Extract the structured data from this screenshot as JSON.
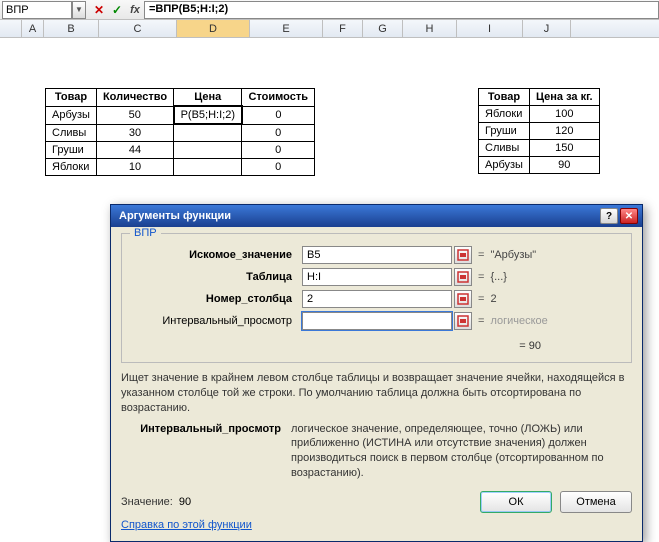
{
  "formula_bar": {
    "name_box": "ВПР",
    "formula": "=ВПР(B5;H:I;2)"
  },
  "columns": {
    "A": "A",
    "B": "B",
    "C": "C",
    "D": "D",
    "E": "E",
    "F": "F",
    "G": "G",
    "H": "H",
    "I": "I",
    "J": "J"
  },
  "main_table": {
    "headers": {
      "tovar": "Товар",
      "qty": "Количество",
      "price": "Цена",
      "cost": "Стоимость"
    },
    "rows": [
      {
        "tovar": "Арбузы",
        "qty": "50",
        "price": "Р(B5;H:I;2)",
        "cost": "0"
      },
      {
        "tovar": "Сливы",
        "qty": "30",
        "price": "",
        "cost": "0"
      },
      {
        "tovar": "Груши",
        "qty": "44",
        "price": "",
        "cost": "0"
      },
      {
        "tovar": "Яблоки",
        "qty": "10",
        "price": "",
        "cost": "0"
      }
    ]
  },
  "price_table": {
    "headers": {
      "tovar": "Товар",
      "ppkg": "Цена за кг."
    },
    "rows": [
      {
        "tovar": "Яблоки",
        "price": "100"
      },
      {
        "tovar": "Груши",
        "price": "120"
      },
      {
        "tovar": "Сливы",
        "price": "150"
      },
      {
        "tovar": "Арбузы",
        "price": "90"
      }
    ]
  },
  "dialog": {
    "title": "Аргументы функции",
    "func_name": "ВПР",
    "labels": {
      "lookup": "Искомое_значение",
      "table": "Таблица",
      "col": "Номер_столбца",
      "range": "Интервальный_просмотр"
    },
    "values": {
      "lookup": "B5",
      "table": "H:I",
      "col": "2",
      "range": ""
    },
    "evals": {
      "lookup": "\"Арбузы\"",
      "table": "{...}",
      "col": "2",
      "range": "логическое"
    },
    "result_eq": "= 90",
    "description": "Ищет значение в крайнем левом столбце таблицы и возвращает значение ячейки, находящейся в указанном столбце той же строки. По умолчанию таблица должна быть отсортирована по возрастанию.",
    "param_name": "Интервальный_просмотр",
    "param_text": "логическое значение, определяющее, точно (ЛОЖЬ) или приближенно (ИСТИНА или отсутствие значения) должен производиться поиск в первом столбце (отсортированном по возрастанию).",
    "value_label": "Значение:",
    "value": "90",
    "help": "Справка по этой функции",
    "ok": "ОК",
    "cancel": "Отмена"
  }
}
